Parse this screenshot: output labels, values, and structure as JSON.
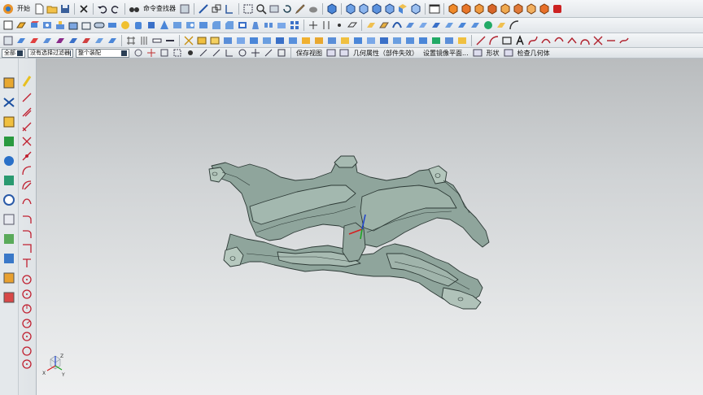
{
  "toolbar": {
    "start_label": "开始",
    "command_finder_label": "命令查找器"
  },
  "selection_bar": {
    "filter_scope_value": "全部",
    "selection_filter_value": "没有选择过滤器",
    "assembly_value": "整个装配",
    "save_view_label": "保存视图",
    "geometry_property_label": "几何属性（部件失效）",
    "set_mirror_plane_label": "设置镜像平面...",
    "shape_label": "形状",
    "check_geometry_label": "检查几何体"
  },
  "triad": {
    "x_label": "X",
    "y_label": "Y",
    "z_label": "Z"
  },
  "colors": {
    "model_fill": "#8fa59c",
    "model_edge": "#2d3a36",
    "x_axis": "#d62020",
    "y_axis": "#1fa324",
    "z_axis": "#2244cc"
  },
  "icons": [
    "start-icon",
    "new-file-icon",
    "open-folder-icon",
    "save-icon",
    "close-icon",
    "undo-icon",
    "redo-icon",
    "binoculars-icon",
    "part-navigator-icon",
    "measure-icon",
    "layer-icon",
    "fit-view-icon",
    "zoom-icon",
    "rotate-icon",
    "shaded-view-icon",
    "cube-view-icon",
    "display-frame-icon",
    "analysis-icon"
  ]
}
